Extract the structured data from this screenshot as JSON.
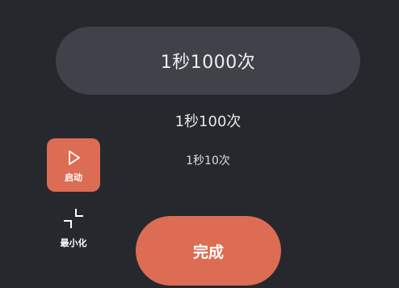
{
  "picker": {
    "selected": "1秒1000次",
    "options": [
      "1秒100次",
      "1秒10次"
    ]
  },
  "controls": {
    "start_label": "启动",
    "minimize_label": "最小化",
    "done_label": "完成"
  },
  "icons": {
    "start": "play-icon",
    "minimize": "minimize-icon"
  },
  "colors": {
    "background": "#26282d",
    "selected_pill": "#3f4249",
    "accent": "#dc6c53",
    "text": "#eeeeee"
  }
}
